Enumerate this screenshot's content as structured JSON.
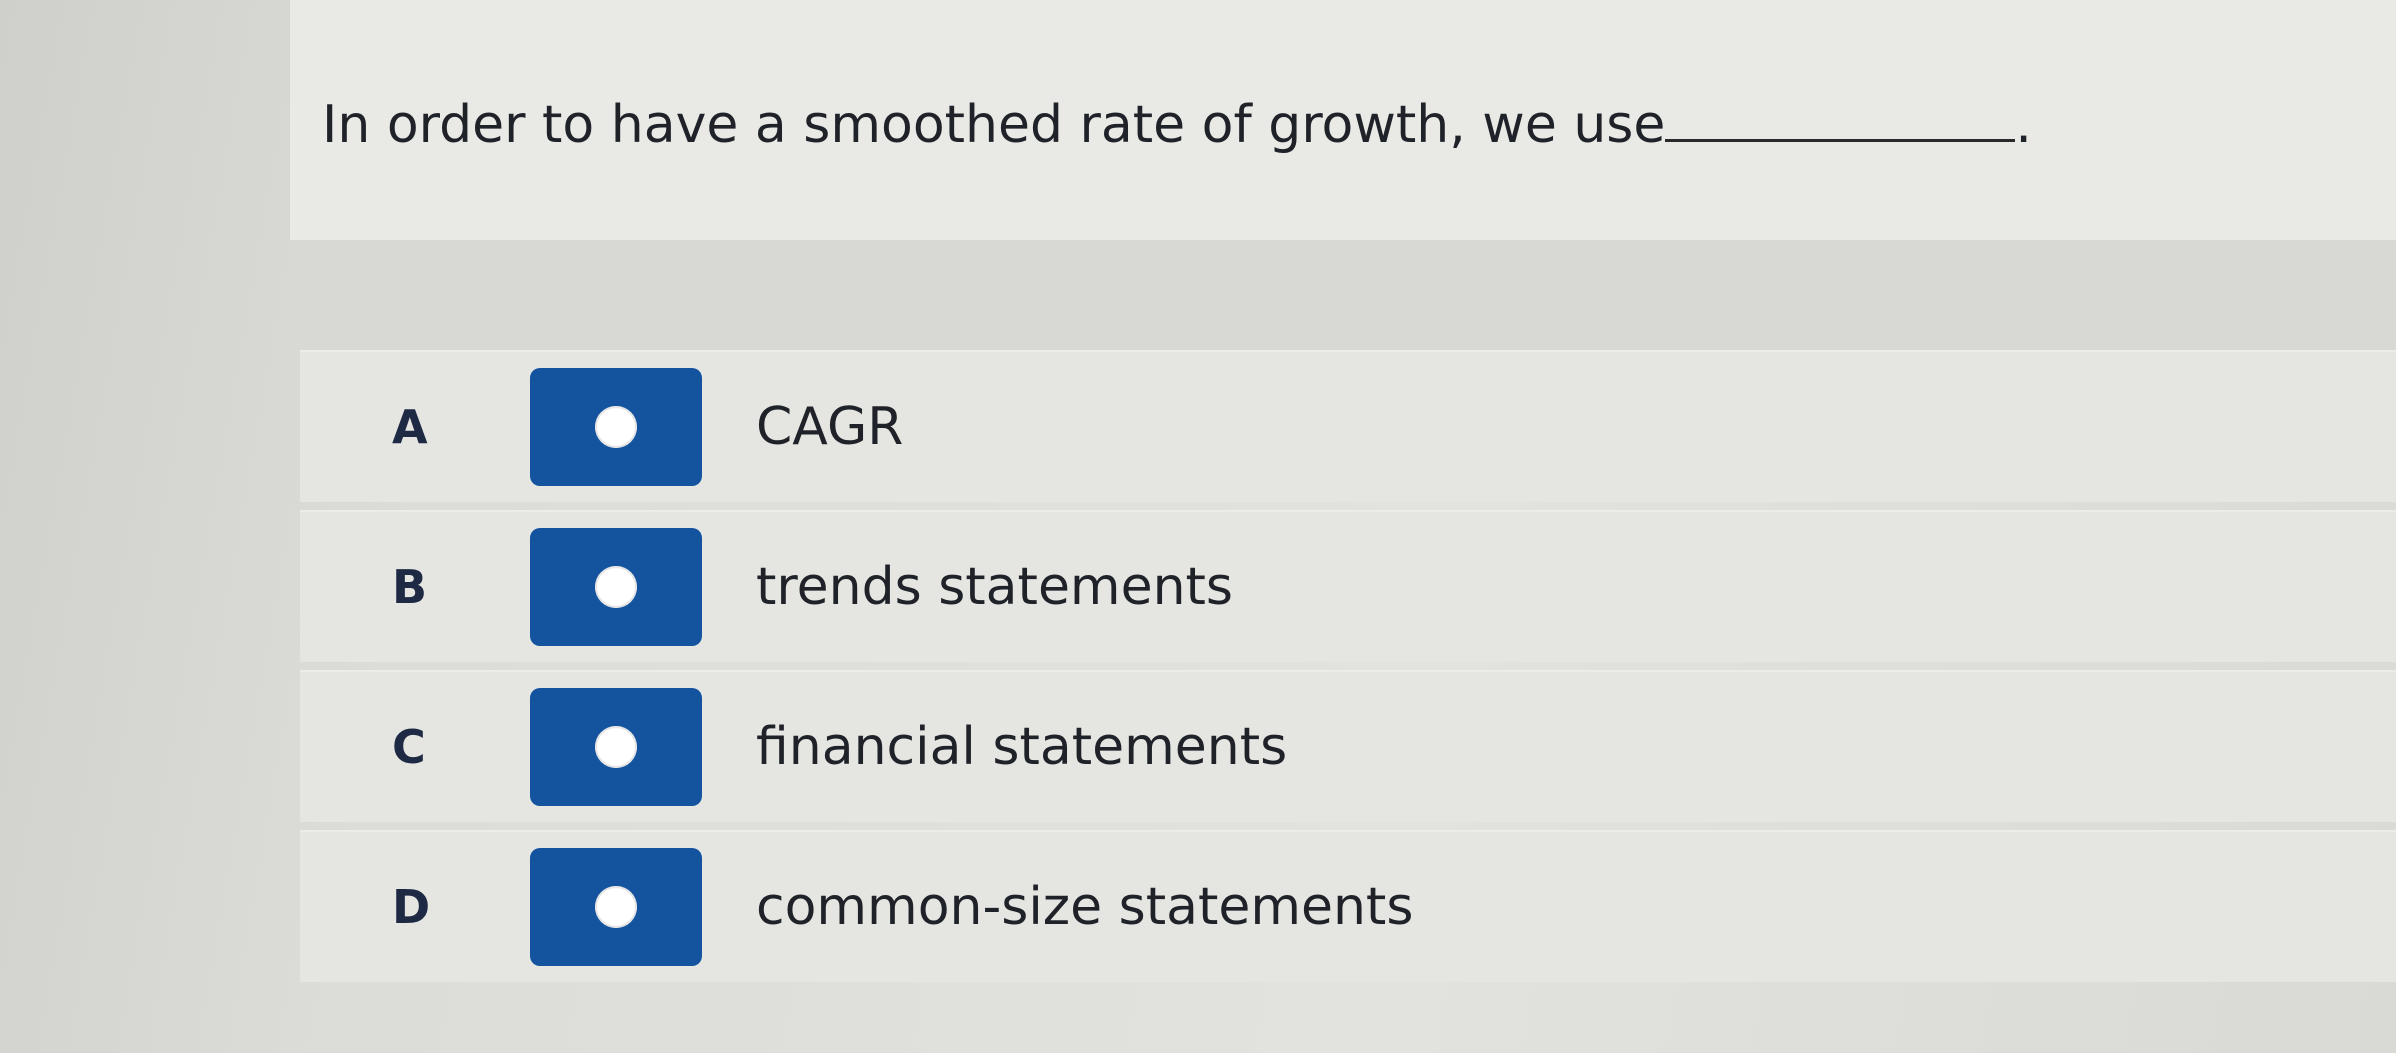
{
  "question": {
    "text": "In order to have a smoothed rate of growth, we use",
    "trailing": "."
  },
  "options": [
    {
      "letter": "A",
      "text": "CAGR"
    },
    {
      "letter": "B",
      "text": "trends statements"
    },
    {
      "letter": "C",
      "text": "financial statements"
    },
    {
      "letter": "D",
      "text": "common-size statements"
    }
  ],
  "colors": {
    "radio_box": "#14549e",
    "radio_dot": "#ffffff"
  }
}
